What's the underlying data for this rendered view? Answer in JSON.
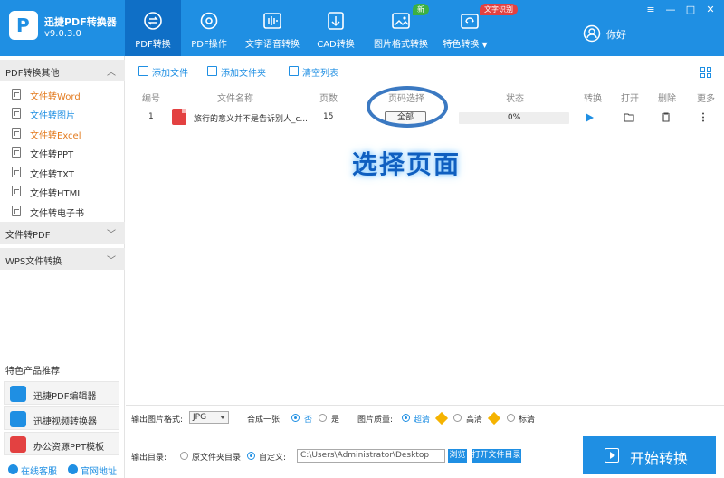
{
  "app": {
    "title": "迅捷PDF转换器",
    "version": "v9.0.3.0",
    "user_greeting": "你好"
  },
  "nav": {
    "tabs": [
      {
        "label": "PDF转换"
      },
      {
        "label": "PDF操作"
      },
      {
        "label": "文字语音转换"
      },
      {
        "label": "CAD转换"
      },
      {
        "label": "图片格式转换"
      },
      {
        "label": "特色转换"
      }
    ],
    "badges": {
      "new": "新",
      "ocr": "文字识别"
    },
    "icons": [
      "convert-icon",
      "pdf-ops-icon",
      "voice-icon",
      "cad-icon",
      "image-icon",
      "special-icon"
    ]
  },
  "window": {
    "controls": [
      "≡",
      "—",
      "□",
      "✕"
    ]
  },
  "sidebar": {
    "sections": [
      {
        "label": "PDF转换其他",
        "chevron": "︿"
      },
      {
        "label": "文件转PDF",
        "chevron": "﹀"
      },
      {
        "label": "WPS文件转换",
        "chevron": "﹀"
      }
    ],
    "items": [
      {
        "label": "文件转Word",
        "color": "#e37b1f"
      },
      {
        "label": "文件转图片",
        "color": "#1f8fe3"
      },
      {
        "label": "文件转Excel",
        "color": "#e37b1f"
      },
      {
        "label": "文件转PPT",
        "color": "#333333"
      },
      {
        "label": "文件转TXT",
        "color": "#333333"
      },
      {
        "label": "文件转HTML",
        "color": "#333333"
      },
      {
        "label": "文件转电子书",
        "color": "#333333"
      }
    ],
    "promo_title": "特色产品推荐",
    "promos": [
      {
        "label": "迅捷PDF编辑器",
        "icon": "pdf-editor-icon",
        "color": "#1f8fe3"
      },
      {
        "label": "迅捷视频转换器",
        "icon": "video-converter-icon",
        "color": "#1f8fe3"
      },
      {
        "label": "办公资源PPT模板",
        "icon": "ppt-template-icon",
        "color": "#e34141"
      }
    ],
    "footer": {
      "support": "在线客服",
      "website": "官网地址"
    }
  },
  "toolbar": {
    "add_file": "添加文件",
    "add_folder": "添加文件夹",
    "clear_list": "清空列表"
  },
  "table": {
    "headers": [
      "编号",
      "文件名称",
      "页数",
      "页码选择",
      "状态",
      "转换",
      "打开",
      "删除",
      "更多"
    ],
    "rows": [
      {
        "index": "1",
        "filename": "旅行的意义并不是告诉别人_c...",
        "pages": "15",
        "page_selection": "全部",
        "progress": 0,
        "progress_text": "0%"
      }
    ]
  },
  "overlay": {
    "annotation": "选择页面"
  },
  "options": {
    "image_format_label": "输出图片格式:",
    "image_format_value": "JPG",
    "merge_label": "合成一张:",
    "merge_options": [
      "否",
      "是"
    ],
    "quality_label": "图片质量:",
    "quality_options": [
      "超清",
      "高清",
      "标清"
    ],
    "output_dir_label": "输出目录:",
    "dir_options": [
      "原文件夹目录",
      "自定义:"
    ],
    "output_path": "C:\\Users\\Administrator\\Desktop",
    "browse": "浏览",
    "open_folder": "打开文件目录",
    "start": "开始转换"
  },
  "colors": {
    "primary": "#1f8fe3",
    "header_active": "#0f6fc6",
    "badge_new": "#3cb043",
    "badge_ocr": "#e34141",
    "premium": "#f5b301"
  }
}
